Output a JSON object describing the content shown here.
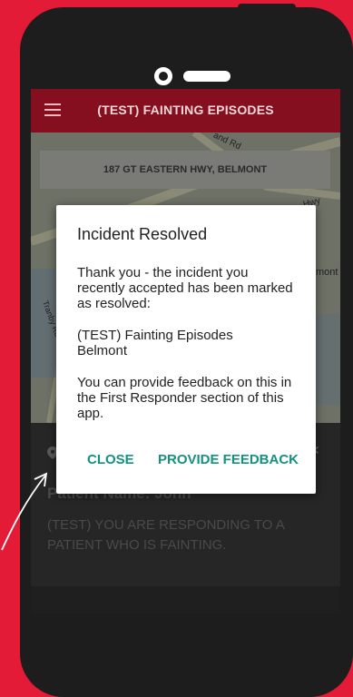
{
  "appbar": {
    "title": "(TEST) FAINTING EPISODES",
    "menu_icon": "hamburger-menu-icon"
  },
  "map": {
    "address": "187 GT EASTERN HWY,  BELMONT",
    "labels": [
      "and Rd",
      "Hwy",
      "mont",
      "Tranby Rd"
    ]
  },
  "incident": {
    "patient_name": "Patient Name: John",
    "description": "(TEST) YOU ARE RESPONDING TO A PATIENT WHO IS FAINTING."
  },
  "dialog": {
    "title": "Incident Resolved",
    "message_1": "Thank you - the incident you recently accepted has been marked as resolved:",
    "incident_name": "(TEST) Fainting Episodes",
    "incident_location": "Belmont",
    "message_2": "You can provide feedback on this in the First Responder section of this app.",
    "close_label": "CLOSE",
    "feedback_label": "PROVIDE FEEDBACK"
  },
  "colors": {
    "background": "#e31b36",
    "appbar": "#850f1e",
    "accent": "#14917f"
  }
}
